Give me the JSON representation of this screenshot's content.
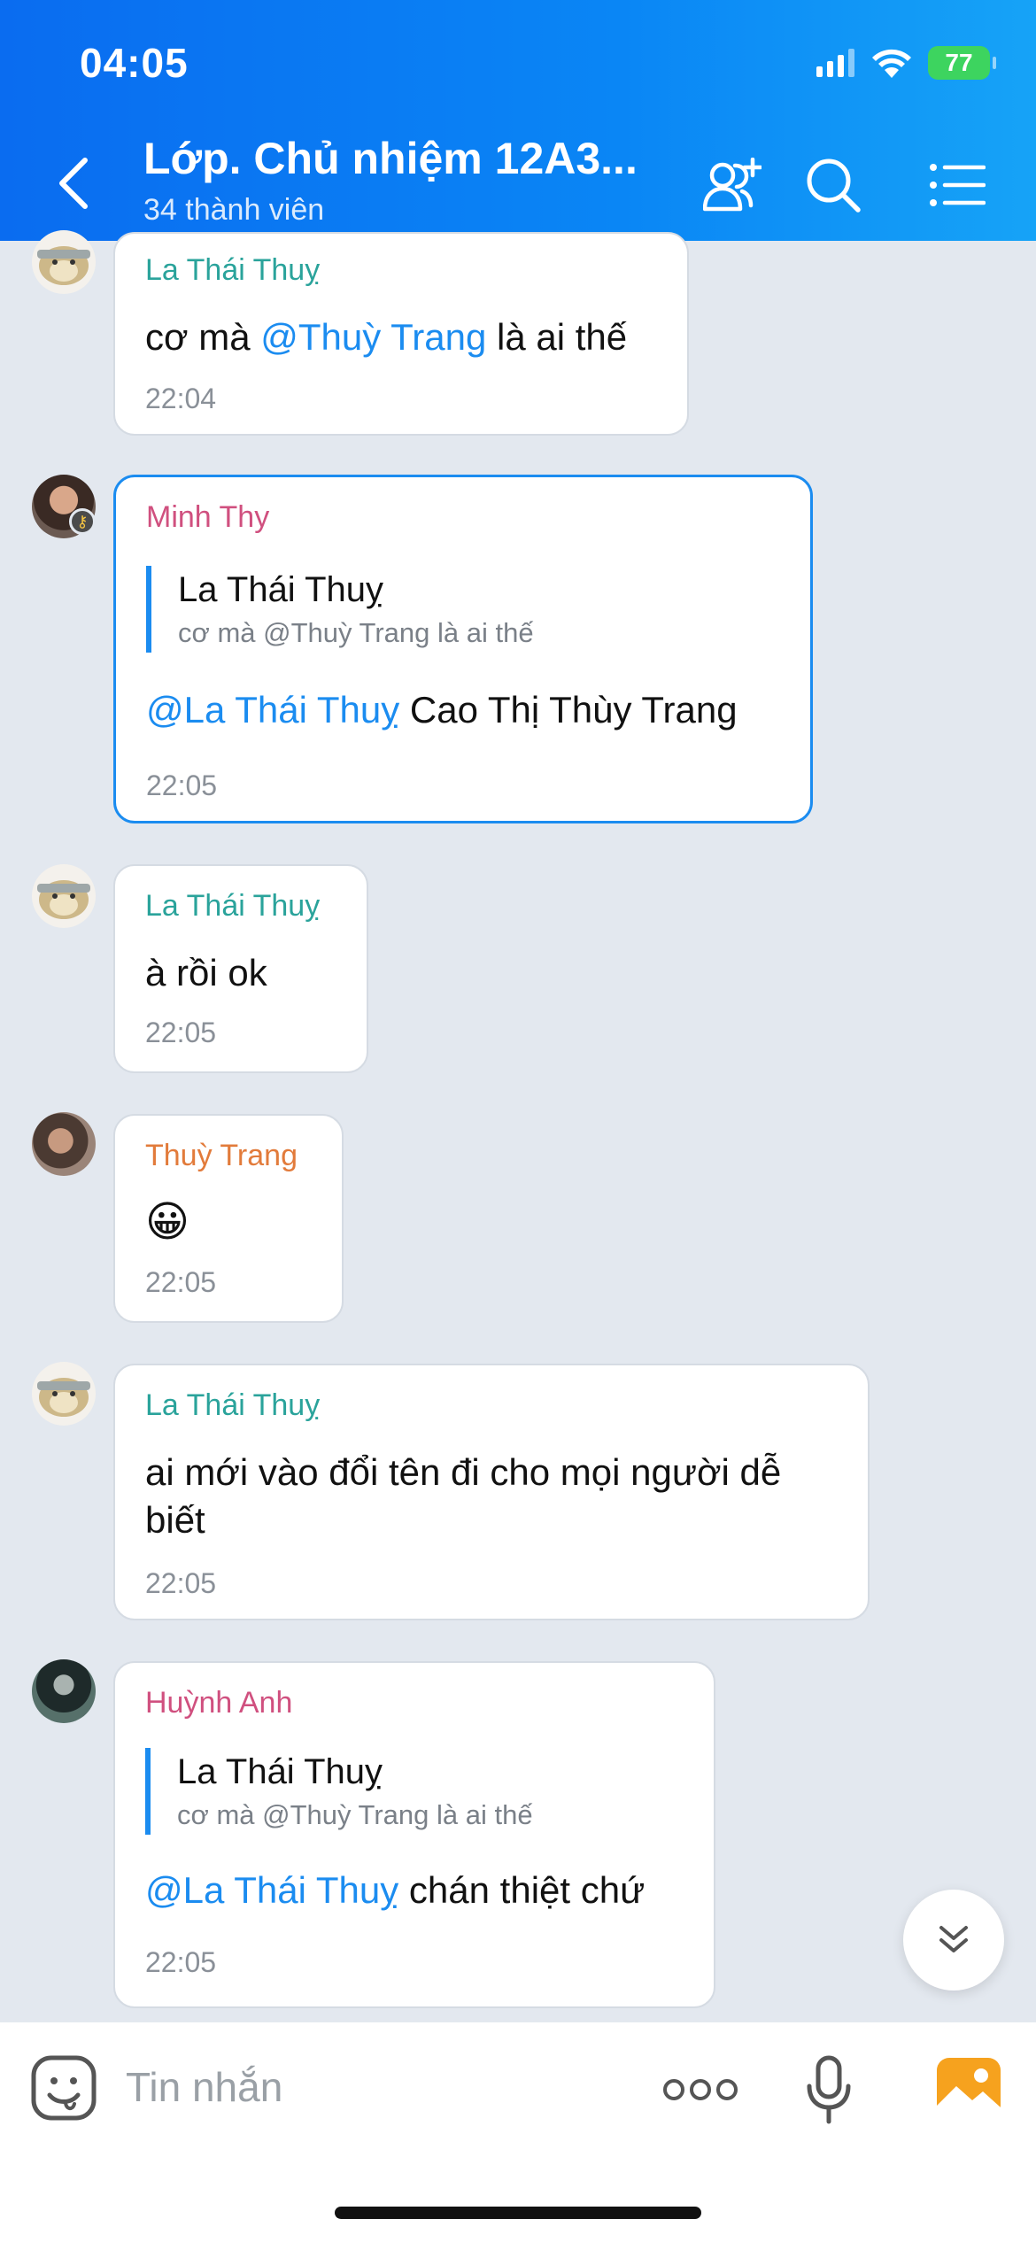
{
  "status_bar": {
    "time": "04:05",
    "battery": "77"
  },
  "header": {
    "title": "Lớp. Chủ nhiệm 12A3...",
    "subtitle": "34 thành viên"
  },
  "messages": [
    {
      "sender": "La Thái Thuỵ",
      "text_before": "cơ mà ",
      "mention": "@Thuỳ Trang",
      "text_after": " là ai thế",
      "time": "22:04"
    },
    {
      "sender": "Minh Thy",
      "quote": {
        "name": "La Thái Thuỵ",
        "text": "cơ mà @Thuỳ Trang là ai thế"
      },
      "mention": "@La Thái Thuỵ",
      "text_after": " Cao Thị Thùy Trang",
      "time": "22:05"
    },
    {
      "sender": "La Thái Thuỵ",
      "text": "à rồi ok",
      "time": "22:05"
    },
    {
      "sender": "Thuỳ Trang",
      "text": "😀",
      "time": "22:05"
    },
    {
      "sender": "La Thái Thuỵ",
      "text_line1": "ai mới vào đổi tên đi cho mọi người dễ",
      "text_line2": "biết",
      "time": "22:05"
    },
    {
      "sender": "Huỳnh Anh",
      "quote": {
        "name": "La Thái Thuỵ",
        "text": "cơ mà @Thuỳ Trang là ai thế"
      },
      "mention": "@La Thái Thuỵ",
      "text_after": " chán thiệt chứ",
      "time": "22:05"
    }
  ],
  "input": {
    "placeholder": "Tin nhắn"
  },
  "colors": {
    "header_start": "#0a6cf0",
    "header_end": "#16a3f7",
    "mention": "#1b8cf0",
    "sender_teal": "#2aa39b",
    "sender_pink": "#d0507f",
    "sender_orange": "#e27b3b",
    "background": "#e3e8ef"
  },
  "icons": [
    "signal-icon",
    "wifi-icon",
    "battery-icon",
    "back-icon",
    "add-member-icon",
    "search-icon",
    "menu-icon",
    "scroll-down-icon",
    "sticker-icon",
    "more-icon",
    "microphone-icon",
    "image-icon"
  ]
}
